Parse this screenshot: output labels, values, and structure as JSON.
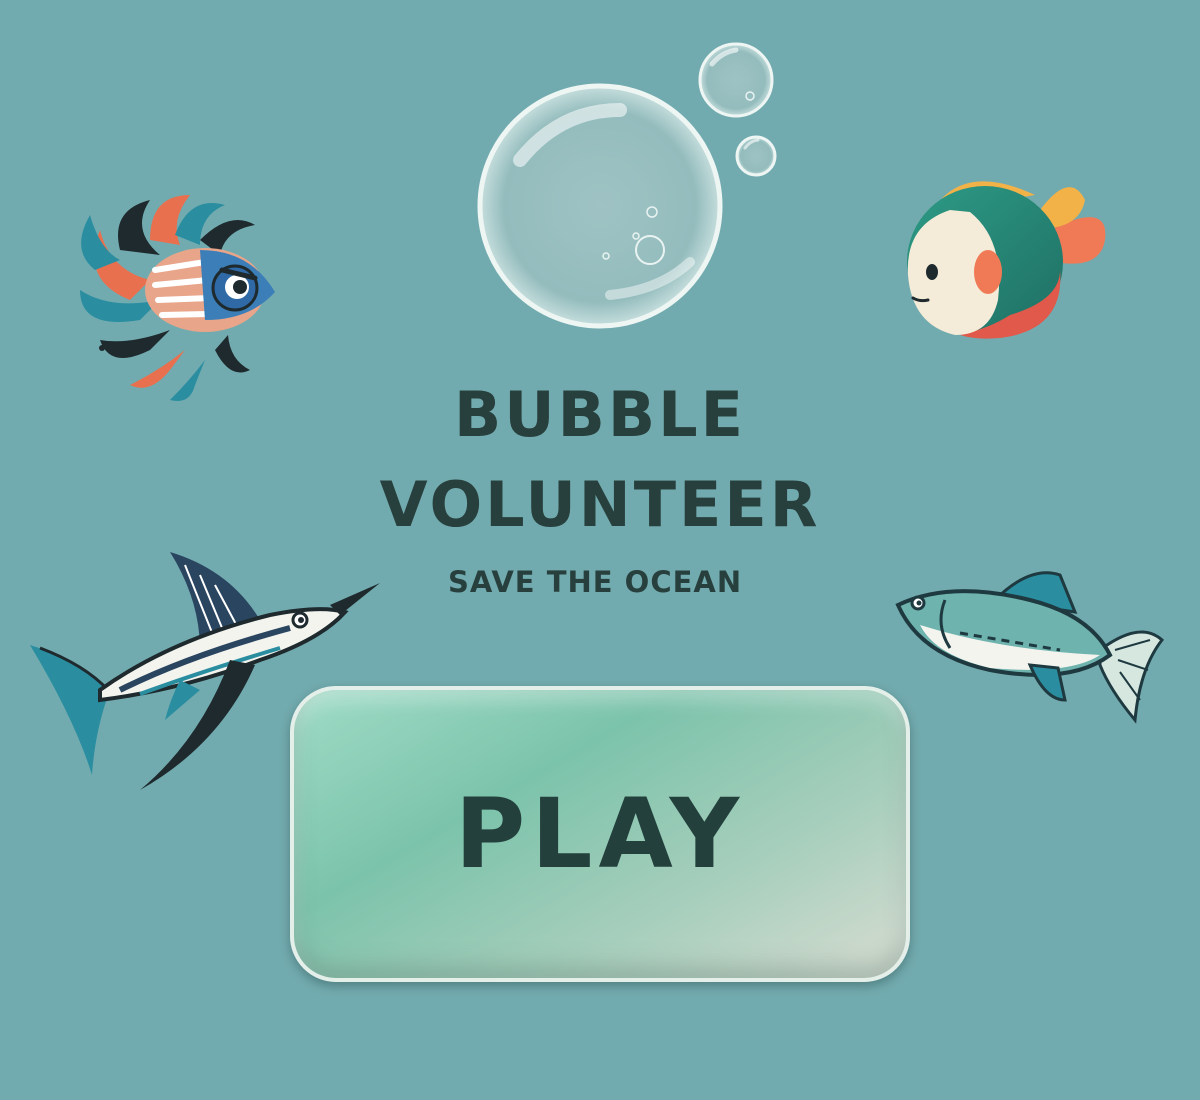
{
  "title": {
    "line1": "BUBBLE",
    "line2": "VOLUNTEER",
    "subtitle": "SAVE THE OCEAN"
  },
  "play_button": {
    "label": "PLAY"
  },
  "colors": {
    "background": "#72abaf",
    "text": "#28403d",
    "button_start": "#9fdcc6",
    "button_end": "#d8ddd2"
  },
  "icons": [
    "bubble-icon",
    "lionfish-icon",
    "cartoon-fish-icon",
    "swordfish-icon",
    "sardine-icon"
  ]
}
